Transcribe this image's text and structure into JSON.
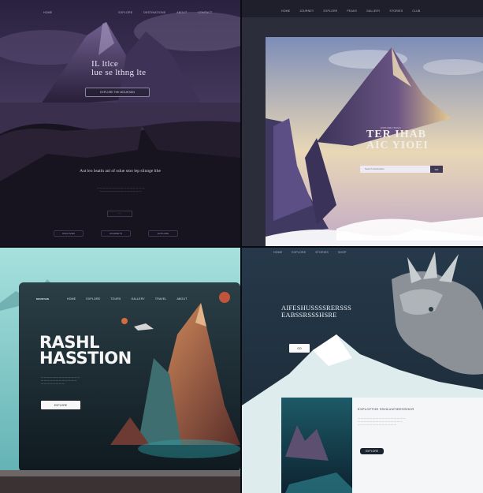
{
  "panels": {
    "p1": {
      "nav": [
        "Home",
        "Explore",
        "Destinations",
        "About",
        "Contact"
      ],
      "hero_title_line1": "IL ltlce",
      "hero_title_line2": "lue se lthng lte",
      "hero_button": "EXPLORE THE MOUNTAIN",
      "tagline": "Aut leo bsatln anl of sslue stoo lep slinnge lthe",
      "footer_items": [
        "DISCOVER",
        "JOURNEYS",
        "EXPLORE"
      ],
      "colors": {
        "bg": "#17131f",
        "accent": "#6a5a8c"
      }
    },
    "p2": {
      "nav": [
        "Home",
        "Journey",
        "Explore",
        "Peaks",
        "Gallery",
        "Stories",
        "Club"
      ],
      "title_small": "EXPLORE TRAILS",
      "title_line1": "TER IHAB",
      "title_line2": "AIC YIOEI",
      "search_placeholder": "Search destination",
      "search_button": "GO",
      "colors": {
        "sky": "#efe3c8",
        "mountain": "#3d3559"
      }
    },
    "p3": {
      "nav": [
        "Home",
        "Explore",
        "Tours",
        "Gallery",
        "Travel",
        "About"
      ],
      "logo": "MOUNTAIN",
      "headline_line1": "RASHL",
      "headline_line2": "HASSTION",
      "cta": "EXPLORE",
      "colors": {
        "bg": "#8fd3d0",
        "mountain": "#b06a4a"
      }
    },
    "p4": {
      "nav": [
        "Home",
        "Explore",
        "Stories",
        "Shop"
      ],
      "headline_line1": "AIFESHUSSSSRERSSS",
      "headline_line2": "EABSSRSSSHSRE",
      "cta": "GO",
      "card_title": "EXPLOFTHE SSHLUNTIEESSHCR",
      "card_button": "EXPLORE",
      "colors": {
        "bg": "#203241",
        "snow": "#eef4f5"
      }
    }
  }
}
